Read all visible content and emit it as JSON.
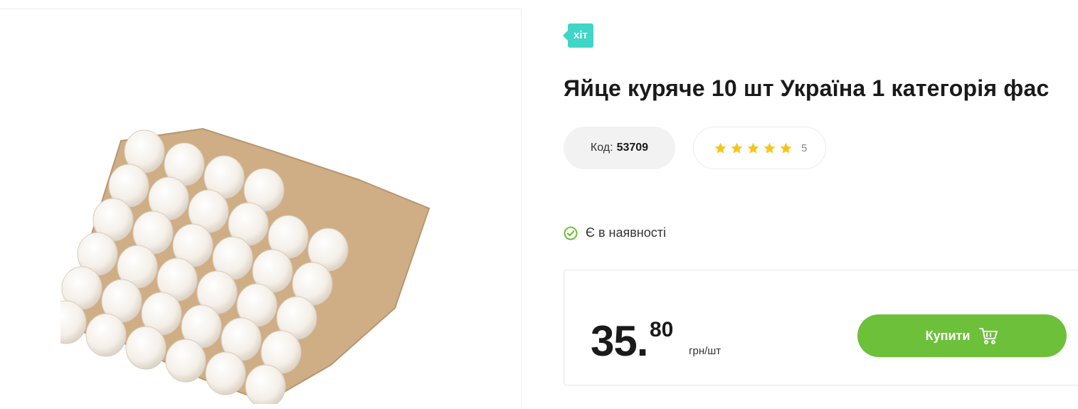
{
  "product": {
    "badge": "хіт",
    "title": "Яйце куряче 10 шт Україна 1 категорія фас",
    "code_label": "Код:",
    "code_value": "53709",
    "rating": 5,
    "rating_count": "5",
    "availability": "Є в наявності",
    "image_icon": "egg-tray-image"
  },
  "price": {
    "integer": "35.",
    "fraction": "80",
    "unit": "грн/шт"
  },
  "buy_button": {
    "label": "Купити",
    "icon": "cart-icon"
  },
  "colors": {
    "badge": "#3fd5c7",
    "star": "#f5c518",
    "check": "#6cc03a",
    "buy_button": "#6cc03a"
  }
}
